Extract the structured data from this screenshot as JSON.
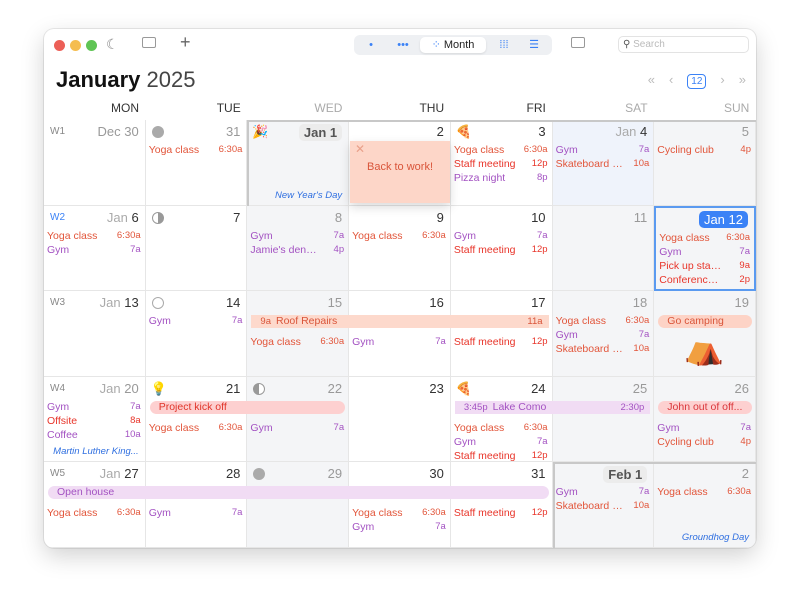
{
  "toolbar": {
    "views": [
      "Day",
      "Week",
      "Month",
      "Year",
      "List"
    ],
    "active_view": "Month",
    "search_placeholder": "Search"
  },
  "header": {
    "month": "January",
    "year": "2025",
    "today_badge": "12"
  },
  "weekdays": [
    "MON",
    "TUE",
    "WED",
    "THU",
    "FRI",
    "SAT",
    "SUN"
  ],
  "colors": {
    "yoga": "#e2553a",
    "meeting": "#e8352a",
    "gym": "#a352c2",
    "accent": "#3b82f6"
  },
  "sticky_note": {
    "text": "Back to work!"
  },
  "weeks": [
    {
      "label": "W1",
      "days": [
        {
          "prefix": "",
          "date": "Dec 30",
          "style": "dim",
          "events": []
        },
        {
          "prefix": "",
          "date": "31",
          "style": "dim",
          "moon": "new",
          "events": [
            {
              "title": "Yoga class",
              "time": "6:30a",
              "color": "yoga"
            }
          ]
        },
        {
          "prefix": "",
          "date": "Jan 1",
          "style": "badge",
          "icon": "🎉",
          "holiday": "New Year's Day",
          "events": []
        },
        {
          "prefix": "",
          "date": "2",
          "events": []
        },
        {
          "prefix": "",
          "date": "3",
          "icon": "🍕",
          "events": [
            {
              "title": "Yoga class",
              "time": "6:30a",
              "color": "yoga"
            },
            {
              "title": "Staff meeting",
              "time": "12p",
              "color": "meeting"
            },
            {
              "title": "Pizza night",
              "time": "8p",
              "color": "gym"
            }
          ]
        },
        {
          "prefix": "Jan ",
          "date": "4",
          "bg": "blue",
          "events": [
            {
              "title": "Gym",
              "time": "7a",
              "color": "gym"
            },
            {
              "title": "Skateboard les...",
              "time": "10a",
              "color": "yoga"
            }
          ]
        },
        {
          "prefix": "",
          "date": "5",
          "style": "dim",
          "events": [
            {
              "title": "Cycling club",
              "time": "4p",
              "color": "yoga"
            }
          ]
        }
      ]
    },
    {
      "label": "W2",
      "current": true,
      "days": [
        {
          "prefix": "Jan ",
          "date": "6",
          "events": [
            {
              "title": "Yoga class",
              "time": "6:30a",
              "color": "yoga"
            },
            {
              "title": "Gym",
              "time": "7a",
              "color": "gym"
            }
          ]
        },
        {
          "prefix": "",
          "date": "7",
          "moon": "first",
          "events": []
        },
        {
          "prefix": "",
          "date": "8",
          "style": "dim",
          "events": [
            {
              "title": "Gym",
              "time": "7a",
              "color": "gym"
            },
            {
              "title": "Jamie's dentist...",
              "time": "4p",
              "color": "gym"
            }
          ]
        },
        {
          "prefix": "",
          "date": "9",
          "events": [
            {
              "title": "Yoga class",
              "time": "6:30a",
              "color": "yoga"
            }
          ]
        },
        {
          "prefix": "",
          "date": "10",
          "events": [
            {
              "title": "Gym",
              "time": "7a",
              "color": "gym"
            },
            {
              "title": "Staff meeting",
              "time": "12p",
              "color": "meeting"
            }
          ]
        },
        {
          "prefix": "",
          "date": "11",
          "style": "dim",
          "events": []
        },
        {
          "prefix": "",
          "date": "Jan 12",
          "style": "today",
          "events": [
            {
              "title": "Yoga class",
              "time": "6:30a",
              "color": "yoga"
            },
            {
              "title": "Gym",
              "time": "7a",
              "color": "gym"
            },
            {
              "title": "Pick up stationary",
              "time": "9a",
              "color": "meeting"
            },
            {
              "title": "Conference call",
              "time": "2p",
              "color": "meeting"
            }
          ]
        }
      ]
    },
    {
      "label": "W3",
      "days": [
        {
          "prefix": "Jan ",
          "date": "13",
          "events": []
        },
        {
          "prefix": "",
          "date": "14",
          "moon": "full",
          "events": [
            {
              "title": "Gym",
              "time": "7a",
              "color": "gym"
            }
          ]
        },
        {
          "prefix": "",
          "date": "15",
          "style": "dim",
          "events": [
            {
              "title": "Yoga class",
              "time": "6:30a",
              "color": "yoga"
            }
          ]
        },
        {
          "prefix": "",
          "date": "16",
          "events": [
            {
              "title": "Gym",
              "time": "7a",
              "color": "gym"
            }
          ]
        },
        {
          "prefix": "",
          "date": "17",
          "events": [
            {
              "title": "Staff meeting",
              "time": "12p",
              "color": "meeting"
            }
          ]
        },
        {
          "prefix": "",
          "date": "18",
          "style": "dim",
          "events": [
            {
              "title": "Yoga class",
              "time": "6:30a",
              "color": "yoga"
            },
            {
              "title": "Gym",
              "time": "7a",
              "color": "gym"
            },
            {
              "title": "Skateboard les...",
              "time": "10a",
              "color": "yoga"
            }
          ]
        },
        {
          "prefix": "",
          "date": "19",
          "style": "dim",
          "sticker": "⛺",
          "events": []
        }
      ]
    },
    {
      "label": "W4",
      "days": [
        {
          "prefix": "Jan ",
          "date": "20",
          "style": "dim",
          "holiday": "Martin Luther King...",
          "events": [
            {
              "title": "Gym",
              "time": "7a",
              "color": "gym"
            },
            {
              "title": "Offsite",
              "time": "8a",
              "color": "meeting"
            },
            {
              "title": "Coffee",
              "time": "10a",
              "color": "gym"
            }
          ]
        },
        {
          "prefix": "",
          "date": "21",
          "icon": "💡",
          "events": [
            {
              "title": "Yoga class",
              "time": "6:30a",
              "color": "yoga"
            }
          ]
        },
        {
          "prefix": "",
          "date": "22",
          "style": "dim",
          "moon": "last",
          "events": [
            {
              "title": "Gym",
              "time": "7a",
              "color": "gym"
            }
          ]
        },
        {
          "prefix": "",
          "date": "23",
          "events": []
        },
        {
          "prefix": "",
          "date": "24",
          "icon": "🍕",
          "events": [
            {
              "title": "Yoga class",
              "time": "6:30a",
              "color": "yoga"
            },
            {
              "title": "Gym",
              "time": "7a",
              "color": "gym"
            },
            {
              "title": "Staff meeting",
              "time": "12p",
              "color": "meeting"
            }
          ]
        },
        {
          "prefix": "",
          "date": "25",
          "style": "dim",
          "events": []
        },
        {
          "prefix": "",
          "date": "26",
          "style": "dim",
          "events": [
            {
              "title": "Gym",
              "time": "7a",
              "color": "gym"
            },
            {
              "title": "Cycling club",
              "time": "4p",
              "color": "yoga"
            }
          ]
        }
      ]
    },
    {
      "label": "W5",
      "days": [
        {
          "prefix": "Jan ",
          "date": "27",
          "events": [
            {
              "title": "Yoga class",
              "time": "6:30a",
              "color": "yoga"
            }
          ]
        },
        {
          "prefix": "",
          "date": "28",
          "events": [
            {
              "title": "Gym",
              "time": "7a",
              "color": "gym"
            }
          ]
        },
        {
          "prefix": "",
          "date": "29",
          "style": "dim",
          "moon": "new",
          "events": []
        },
        {
          "prefix": "",
          "date": "30",
          "events": [
            {
              "title": "Yoga class",
              "time": "6:30a",
              "color": "yoga"
            },
            {
              "title": "Gym",
              "time": "7a",
              "color": "gym"
            }
          ]
        },
        {
          "prefix": "",
          "date": "31",
          "events": [
            {
              "title": "Staff meeting",
              "time": "12p",
              "color": "meeting"
            }
          ]
        },
        {
          "prefix": "",
          "date": "Feb 1",
          "style": "badge",
          "events": [
            {
              "title": "Gym",
              "time": "7a",
              "color": "gym"
            },
            {
              "title": "Skateboard les...",
              "time": "10a",
              "color": "yoga"
            }
          ]
        },
        {
          "prefix": "",
          "date": "2",
          "style": "dim",
          "holiday": "Groundhog Day",
          "events": [
            {
              "title": "Yoga class",
              "time": "6:30a",
              "color": "yoga"
            }
          ]
        }
      ]
    }
  ],
  "multi_day_events": [
    {
      "week": 2,
      "start_day": "WED",
      "end_day": "FRI",
      "title": "Roof Repairs",
      "start_time": "9a",
      "end_time": "11a",
      "bg": "#fdd9cc",
      "fg": "#d9553a"
    },
    {
      "week": 2,
      "start_day": "SUN",
      "end_day": "SUN",
      "title": "Go camping",
      "bg": "#fdd3c6",
      "fg": "#d9553a",
      "pill": true
    },
    {
      "week": 3,
      "start_day": "TUE",
      "end_day": "WED",
      "title": "Project kick off",
      "bg": "#fdd0d0",
      "fg": "#e0352a",
      "pill": true
    },
    {
      "week": 3,
      "start_day": "FRI",
      "end_day": "SAT",
      "title": "Lake Como",
      "start_time": "3:45p",
      "end_time": "2:30p",
      "bg": "#f1dcf4",
      "fg": "#a352c2"
    },
    {
      "week": 3,
      "start_day": "SUN",
      "end_day": "SUN",
      "title": "John out of off...",
      "bg": "#fdd0d0",
      "fg": "#d9353a",
      "pill": true
    },
    {
      "week": 4,
      "start_day": "MON",
      "end_day": "FRI",
      "title": "Open house",
      "bg": "#f1dcf4",
      "fg": "#a352c2",
      "pill": true
    }
  ]
}
